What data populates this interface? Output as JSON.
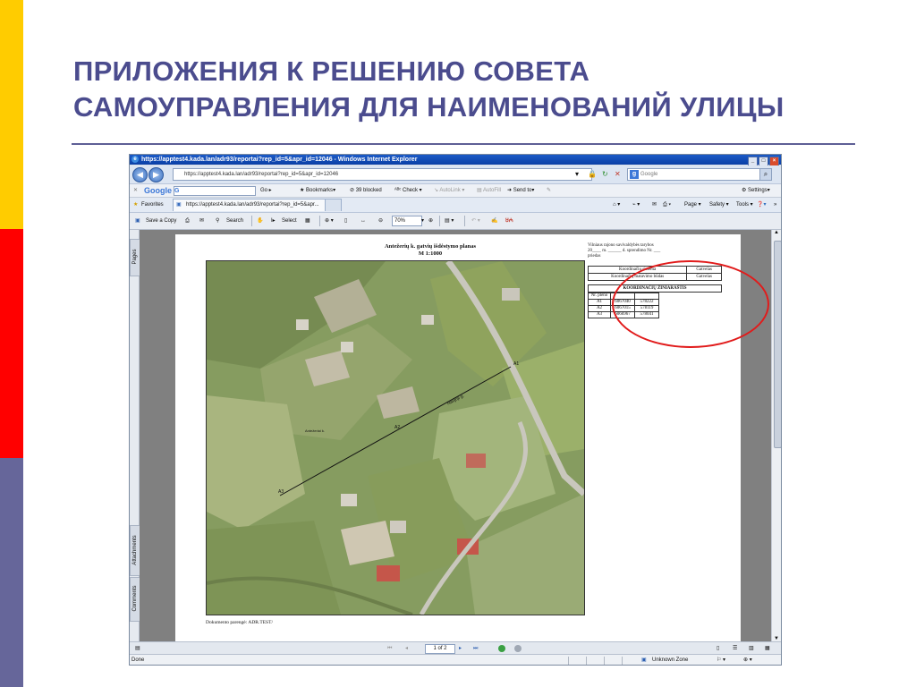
{
  "slide": {
    "title_line1": "ПРИЛОЖЕНИЯ К РЕШЕНИЮ СОВЕТА",
    "title_line2": "САМОУПРАВЛЕНИЯ ДЛЯ НАИМЕНОВАНИЙ УЛИЦЫ",
    "stripe_colors": [
      "#ffcc00",
      "#ff0000",
      "#66669a"
    ]
  },
  "window": {
    "title": "https://apptest4.kada.lan/adr93/reportai?rep_id=5&apr_id=12046 - Windows Internet Explorer",
    "address": "https://apptest4.kada.lan/adr93/reportai?rep_id=5&apr_id=12046",
    "search_placeholder": "Google"
  },
  "google_toolbar": {
    "logo": "Google",
    "query": "G",
    "go": "Go",
    "bookmarks": "Bookmarks",
    "blocked": "39 blocked",
    "check": "Check",
    "autolink": "AutoLink",
    "autofill": "AutoFill",
    "send_to": "Send to",
    "settings": "Settings"
  },
  "favorites_bar": {
    "favorites": "Favorites",
    "tab_label": "https://apptest4.kada.lan/adr93/reportai?rep_id=5&apr...",
    "page": "Page",
    "safety": "Safety",
    "tools": "Tools"
  },
  "pdf_toolbar": {
    "save_copy": "Save a Copy",
    "search": "Search",
    "select": "Select",
    "zoom": "70%"
  },
  "left_tabs": {
    "pages": "Pages",
    "attachments": "Attachments",
    "comments": "Comments"
  },
  "document": {
    "title_line1": "Antežerių k. gatvių išdėstymo planas",
    "title_line2": "M 1:1000",
    "approval_lines": [
      "Vilniaus rajono  savivaldybės tarybos",
      "20____ m. ______ d. sprendimo Nr. ___",
      "priedas"
    ],
    "info_table": [
      [
        "Koordinačių sistema",
        "Gatvelas"
      ],
      [
        "Koordinačių matavimo būdas",
        "Gatvelas"
      ]
    ],
    "coords_header": "KOORDINAČIŲ ŽINIARAŠTIS",
    "coords_columns": [
      "Nr. pleno",
      "",
      ""
    ],
    "coords_rows": [
      [
        "A1",
        "6067040",
        "578222"
      ],
      [
        "A2",
        "6067015",
        "578119"
      ],
      [
        "A3",
        "6066967",
        "578041"
      ]
    ],
    "map_labels": {
      "a1": "A1",
      "a2": "A2",
      "a3": "A3",
      "street": "Naujoji g.",
      "settlement": "Antežeriai k."
    },
    "footer": "Dokumento parengė:    ADR.TEST/"
  },
  "bottom_bar": {
    "page_indicator": "1 of 2"
  },
  "status_bar": {
    "done": "Done",
    "zone": "Unknown Zone"
  }
}
